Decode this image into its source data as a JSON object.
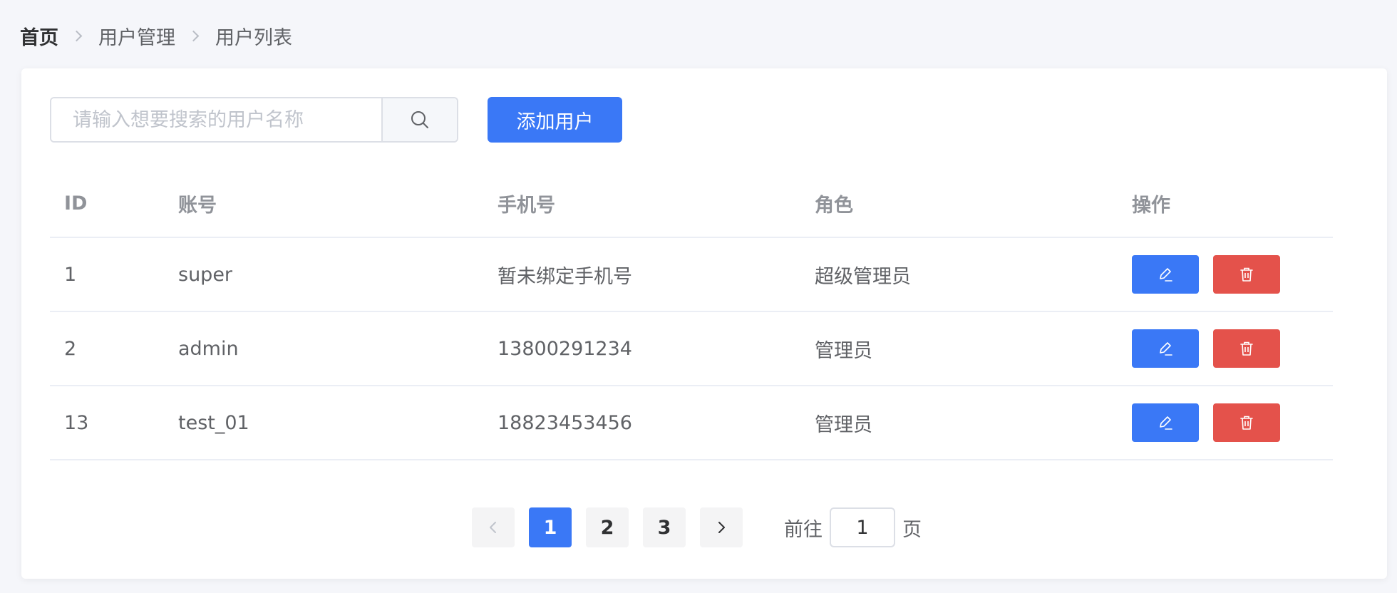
{
  "breadcrumb": {
    "items": [
      "首页",
      "用户管理",
      "用户列表"
    ]
  },
  "toolbar": {
    "search_placeholder": "请输入想要搜索的用户名称",
    "search_icon": "search-icon",
    "add_label": "添加用户"
  },
  "table": {
    "headers": {
      "id": "ID",
      "account": "账号",
      "phone": "手机号",
      "role": "角色",
      "actions": "操作"
    },
    "rows": [
      {
        "id": "1",
        "account": "super",
        "phone": "暂未绑定手机号",
        "role": "超级管理员"
      },
      {
        "id": "2",
        "account": "admin",
        "phone": "13800291234",
        "role": "管理员"
      },
      {
        "id": "13",
        "account": "test_01",
        "phone": "18823453456",
        "role": "管理员"
      }
    ],
    "edit_icon": "edit-icon",
    "delete_icon": "trash-icon"
  },
  "pagination": {
    "pages": [
      "1",
      "2",
      "3"
    ],
    "current_page": "1",
    "goto_prefix": "前往",
    "goto_value": "1",
    "goto_suffix": "页"
  },
  "colors": {
    "primary": "#3a78f6",
    "danger": "#e4524b"
  }
}
